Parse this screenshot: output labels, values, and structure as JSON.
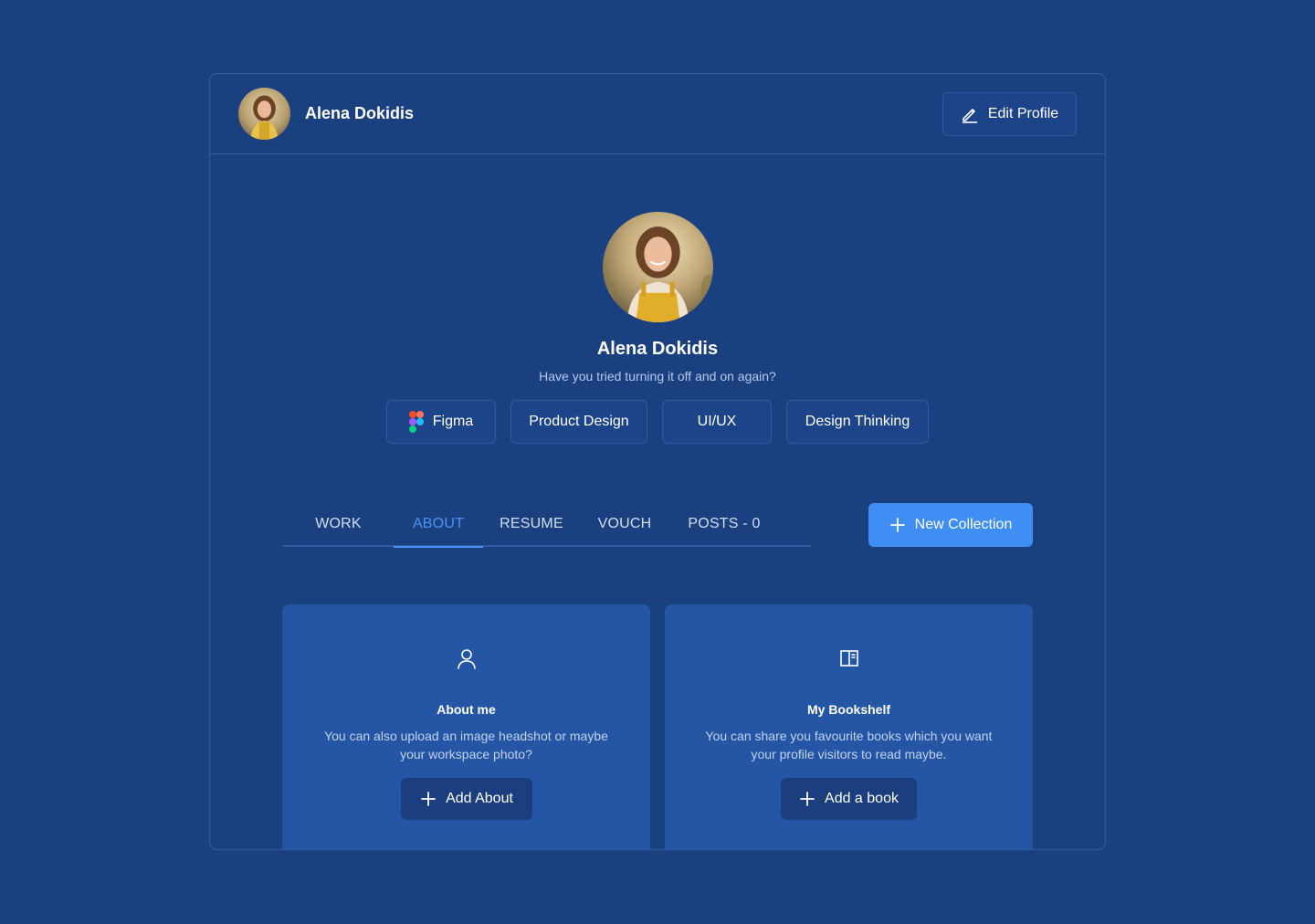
{
  "header": {
    "user_name": "Alena Dokidis",
    "edit_label": "Edit Profile"
  },
  "profile": {
    "name": "Alena Dokidis",
    "tagline": "Have you tried turning it off and on again?",
    "skills": [
      "Figma",
      "Product Design",
      "UI/UX",
      "Design Thinking"
    ]
  },
  "tabs": [
    {
      "label": "WORK",
      "active": false
    },
    {
      "label": "ABOUT",
      "active": true
    },
    {
      "label": "RESUME",
      "active": false
    },
    {
      "label": "VOUCH",
      "active": false
    },
    {
      "label": "POSTS - 0",
      "active": false
    }
  ],
  "new_collection_label": "New Collection",
  "panels": {
    "about": {
      "icon": "user-icon",
      "title": "About me",
      "desc_line1": "You can also upload an image headshot or maybe",
      "desc_line2": "your workspace photo?",
      "button_label": "Add About"
    },
    "bookshelf": {
      "icon": "book-icon",
      "title": "My Bookshelf",
      "desc_line1": "You can share you favourite books which you want",
      "desc_line2": "your profile visitors to read maybe.",
      "button_label": "Add a book"
    }
  },
  "colors": {
    "background": "#1b4080",
    "panel": "#2556a5",
    "accent": "#3f8ef4",
    "active_tab": "#4c93f5"
  }
}
